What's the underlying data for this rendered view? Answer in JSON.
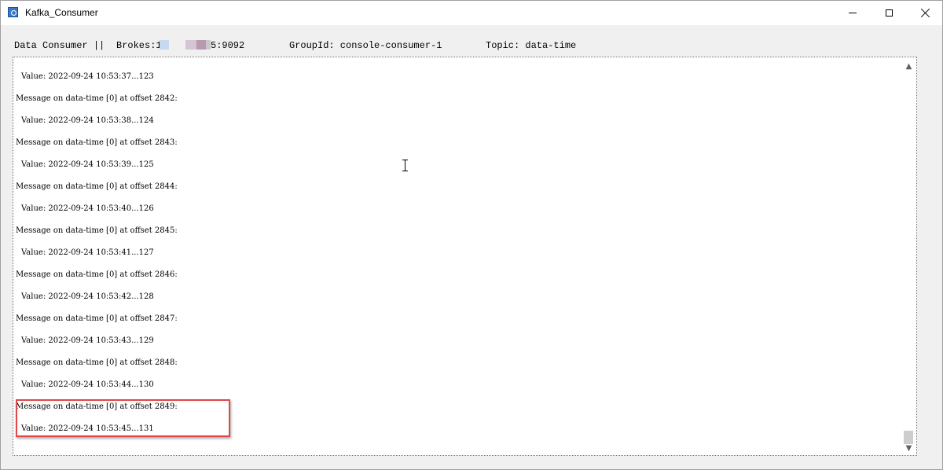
{
  "window": {
    "title": "Kafka_Consumer",
    "icon": "app-window-icon",
    "controls": [
      "minimize-icon",
      "maximize-icon",
      "close-icon"
    ]
  },
  "header": {
    "label": "Data Consumer ||",
    "brokers_prefix": "Brokes:1",
    "brokers_suffix": "5:9092",
    "group": "GroupId: console-consumer-1",
    "topic": "Topic: data-time"
  },
  "log": {
    "lines": [
      {
        "type": "value",
        "text": "Value: 2022-09-24 10:53:37...123"
      },
      {
        "type": "message",
        "text": "Message on data-time [0] at offset 2842:"
      },
      {
        "type": "value",
        "text": "Value: 2022-09-24 10:53:38...124"
      },
      {
        "type": "message",
        "text": "Message on data-time [0] at offset 2843:"
      },
      {
        "type": "value",
        "text": "Value: 2022-09-24 10:53:39...125"
      },
      {
        "type": "message",
        "text": "Message on data-time [0] at offset 2844:"
      },
      {
        "type": "value",
        "text": "Value: 2022-09-24 10:53:40...126"
      },
      {
        "type": "message",
        "text": "Message on data-time [0] at offset 2845:"
      },
      {
        "type": "value",
        "text": "Value: 2022-09-24 10:53:41...127"
      },
      {
        "type": "message",
        "text": "Message on data-time [0] at offset 2846:"
      },
      {
        "type": "value",
        "text": "Value: 2022-09-24 10:53:42...128"
      },
      {
        "type": "message",
        "text": "Message on data-time [0] at offset 2847:"
      },
      {
        "type": "value",
        "text": "Value: 2022-09-24 10:53:43...129"
      },
      {
        "type": "message",
        "text": "Message on data-time [0] at offset 2848:"
      },
      {
        "type": "value",
        "text": "Value: 2022-09-24 10:53:44...130"
      },
      {
        "type": "message",
        "text": "Message on data-time [0] at offset 2849:"
      },
      {
        "type": "value",
        "text": "Value: 2022-09-24 10:53:45...131"
      }
    ]
  },
  "colors": {
    "highlight": "#e0484a",
    "redaction": [
      "#c8d8ee",
      "#d6c4d2",
      "#b89ab0",
      "#c9c9c9"
    ]
  }
}
